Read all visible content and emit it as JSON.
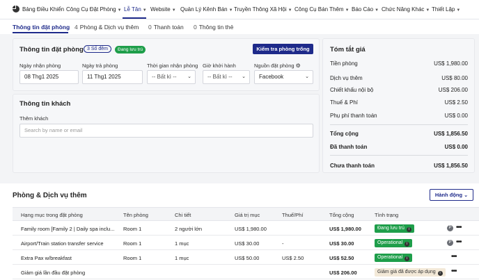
{
  "nav": {
    "items": [
      {
        "label": "Bảng Điều Khiển"
      },
      {
        "label": "Công Cụ Đặt Phòng"
      },
      {
        "label": "Lễ Tân"
      },
      {
        "label": "Website"
      },
      {
        "label": "Quản Lý Kênh Bán"
      },
      {
        "label": "Truyền Thông Xã Hội"
      },
      {
        "label": "Công Cụ Bán Thêm"
      },
      {
        "label": "Báo Cáo"
      },
      {
        "label": "Chức Năng Khác"
      },
      {
        "label": "Thiết Lập"
      }
    ],
    "active_index": 2,
    "accent_color": "#1e2a8a"
  },
  "tabs": [
    {
      "count": "",
      "label": "Thông tin đặt phòng"
    },
    {
      "count": "4",
      "label": "Phòng & Dịch vụ thêm"
    },
    {
      "count": "0",
      "label": "Thanh toán"
    },
    {
      "count": "0",
      "label": "Thông tin thẻ"
    }
  ],
  "booking": {
    "title": "Thông tin đặt phòng",
    "nights_badge": "3 Số đêm",
    "status_badge": "Đang lưu trú",
    "check_button": "Kiểm tra phòng trống",
    "fields": {
      "checkin_label": "Ngày nhận phòng",
      "checkin_value": "08 Thg1 2025",
      "checkout_label": "Ngày trả phòng",
      "checkout_value": "11 Thg1 2025",
      "arrival_time_label": "Thời gian nhận phòng",
      "arrival_time_value": "-- Bất kì --",
      "departure_time_label": "Giờ khởi hành",
      "departure_time_value": "-- Bất kì --",
      "source_label": "Nguồn đặt phòng",
      "source_value": "Facebook"
    }
  },
  "guest": {
    "title": "Thông tin khách",
    "add_label": "Thêm khách",
    "search_placeholder": "Search by name or email"
  },
  "summary": {
    "title": "Tóm tắt giá",
    "rows": [
      {
        "label": "Tiền phòng",
        "value": "US$ 1,980.00"
      },
      {
        "label": "Dịch vụ thêm",
        "value": "US$ 80.00"
      },
      {
        "label": "Chiết khấu nội bộ",
        "value": "US$ 206.00"
      },
      {
        "label": "Thuế & Phí",
        "value": "US$ 2.50"
      },
      {
        "label": "Phụ phí thanh toán",
        "value": "US$ 0.00"
      }
    ],
    "total_label": "Tổng cộng",
    "total_value": "US$ 1,856.50",
    "paid_label": "Đã thanh toán",
    "paid_value": "US$ 0.00",
    "unpaid_label": "Chưa thanh toán",
    "unpaid_value": "US$ 1,856.50"
  },
  "rooms": {
    "title": "Phòng & Dịch vụ thêm",
    "action_button": "Hành động",
    "columns": [
      "Hạng mục trong đặt phòng",
      "Tên phòng",
      "Chi tiết",
      "Giá trị mục",
      "Thuế/Phí",
      "Tổng cộng",
      "Tình trạng"
    ],
    "rows": [
      {
        "item": "Family room [Family 2 | Daily spa inclu...",
        "room": "Room 1",
        "detail": "2 người lớn",
        "value": "US$ 1,980.00",
        "tax": "",
        "total": "US$ 1,980.00",
        "status": "Đang lưu trú",
        "status_style": "green"
      },
      {
        "item": "Airport/Train station transfer service",
        "room": "Room 1",
        "detail": "1 mục",
        "value": "US$ 30.00",
        "tax": "-",
        "total": "US$ 30.00",
        "status": "Operational",
        "status_style": "green"
      },
      {
        "item": "Extra Pax w/breakfast",
        "room": "Room 1",
        "detail": "1 mục",
        "value": "US$ 50.00",
        "tax": "US$ 2.50",
        "total": "US$ 52.50",
        "status": "Operational",
        "status_style": "green"
      },
      {
        "item": "Giảm giá lần đầu đặt phòng",
        "room": "",
        "detail": "",
        "value": "",
        "tax": "",
        "total": "US$ 206.00",
        "status": "Giảm giá đã được áp dụng",
        "status_style": "beige"
      }
    ]
  }
}
